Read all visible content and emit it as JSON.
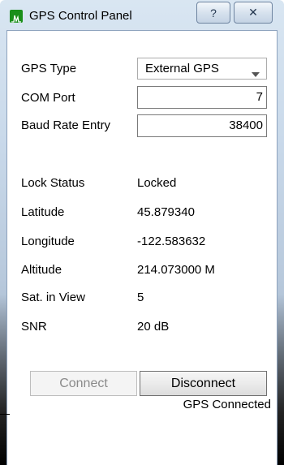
{
  "window": {
    "title": "GPS Control Panel",
    "help_label": "?",
    "close_label": "✕"
  },
  "form": {
    "gps_type_label": "GPS Type",
    "gps_type_value": "External GPS",
    "com_port_label": "COM Port",
    "com_port_value": "7",
    "baud_label": "Baud Rate Entry",
    "baud_value": "38400"
  },
  "status_fields": [
    {
      "label": "Lock Status",
      "value": "Locked"
    },
    {
      "label": "Latitude",
      "value": "45.879340"
    },
    {
      "label": "Longitude",
      "value": "-122.583632"
    },
    {
      "label": "Altitude",
      "value": "214.073000 M"
    },
    {
      "label": "Sat. in View",
      "value": "5"
    },
    {
      "label": "SNR",
      "value": "20 dB"
    }
  ],
  "buttons": {
    "connect_label": "Connect",
    "disconnect_label": "Disconnect"
  },
  "connection_status": "GPS Connected"
}
